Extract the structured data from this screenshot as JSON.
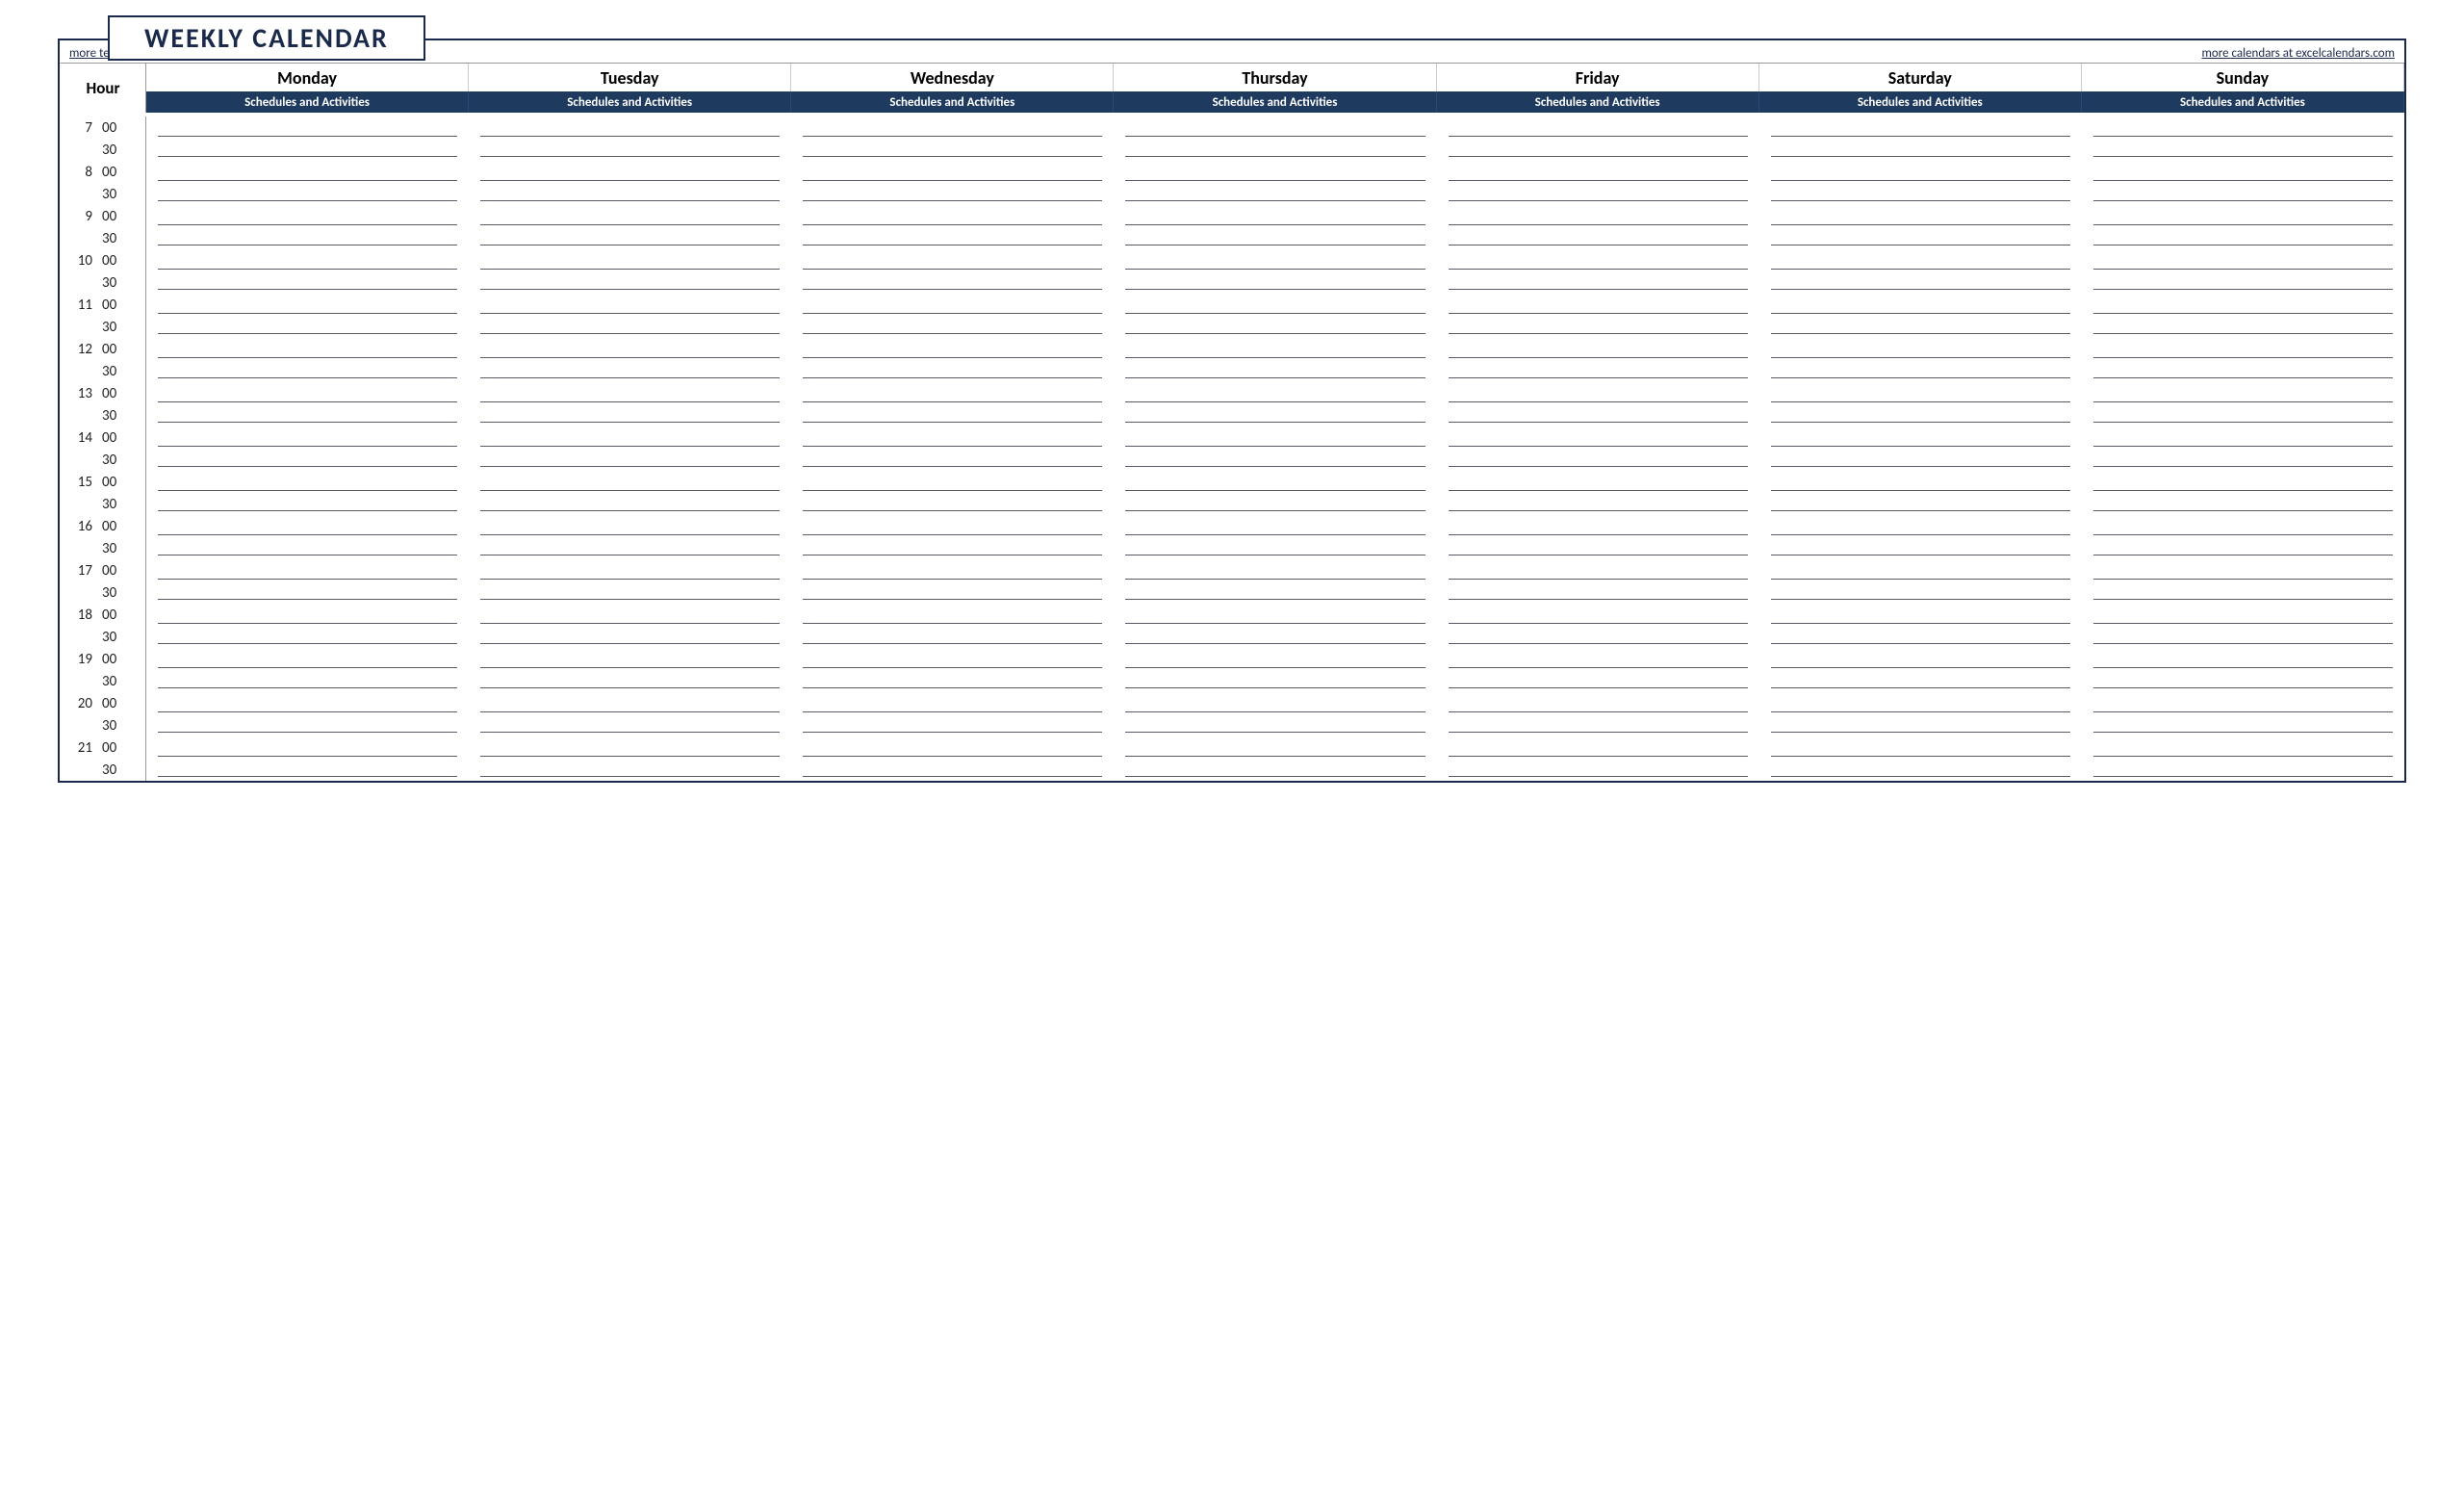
{
  "title": "WEEKLY CALENDAR",
  "links": {
    "left": "more templates at exceltemplate.net",
    "right": "more calendars at excelcalendars.com"
  },
  "hour_label": "Hour",
  "subheader": "Schedules and Activities",
  "minute_labels": {
    "m00": "00",
    "m30": "30"
  },
  "days": [
    "Monday",
    "Tuesday",
    "Wednesday",
    "Thursday",
    "Friday",
    "Saturday",
    "Sunday"
  ],
  "hours": [
    "7",
    "8",
    "9",
    "10",
    "11",
    "12",
    "13",
    "14",
    "15",
    "16",
    "17",
    "18",
    "19",
    "20",
    "21"
  ],
  "colors": {
    "header_bg": "#1f3a5f",
    "border_dark": "#1a2a4a"
  }
}
